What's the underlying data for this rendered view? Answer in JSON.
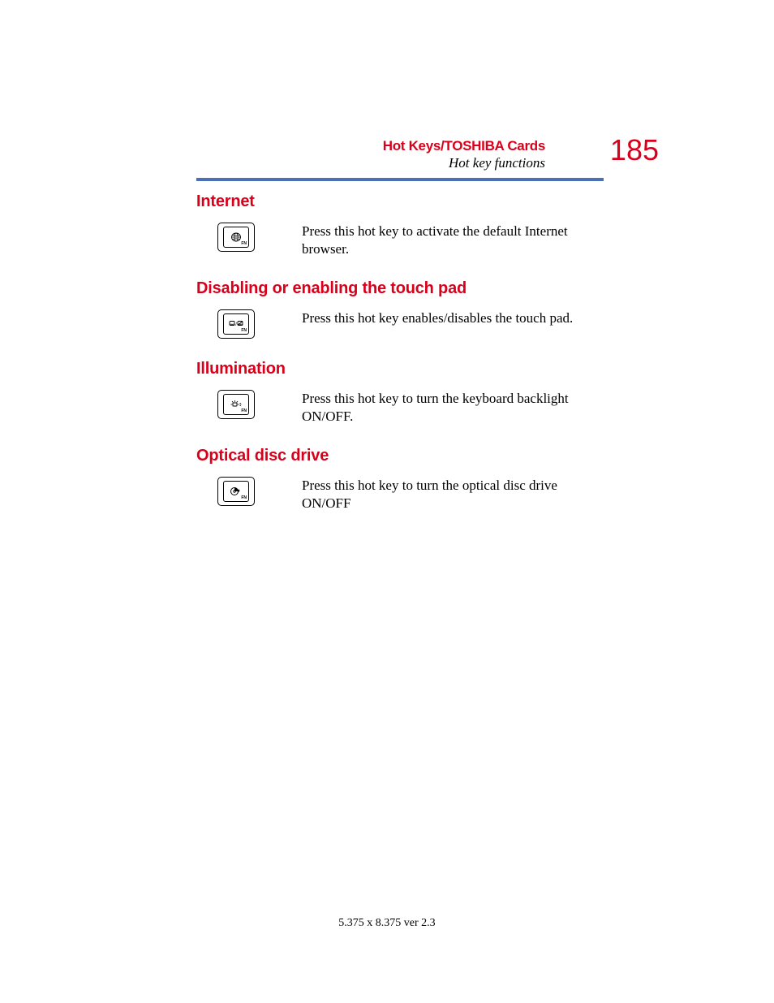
{
  "header": {
    "chapter": "Hot Keys/TOSHIBA Cards",
    "section": "Hot key functions",
    "page_number": "185"
  },
  "sections": [
    {
      "title": "Internet",
      "description": "Press this hot key to activate the default Internet browser."
    },
    {
      "title": "Disabling or enabling the touch pad",
      "description": "Press this hot key enables/disables the touch pad."
    },
    {
      "title": "Illumination",
      "description": "Press this hot key to turn the keyboard backlight ON/OFF."
    },
    {
      "title": "Optical disc drive",
      "description": "Press this hot key to turn the optical disc drive ON/OFF"
    }
  ],
  "footer": "5.375 x 8.375 ver 2.3"
}
